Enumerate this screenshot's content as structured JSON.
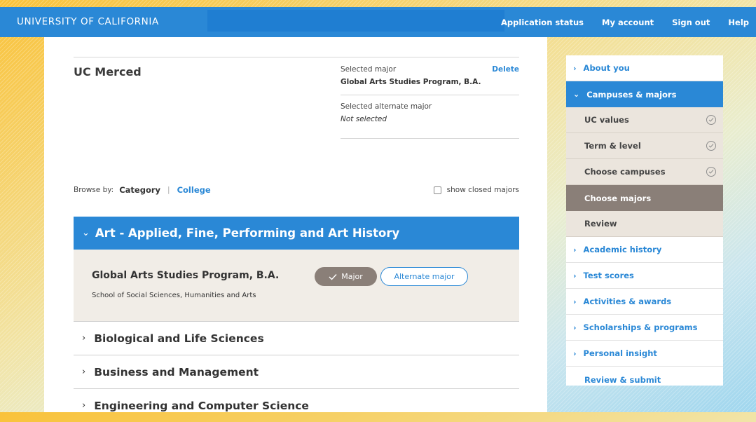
{
  "header": {
    "brand": "UNIVERSITY OF CALIFORNIA",
    "nav": [
      "Application status",
      "My account",
      "Sign out",
      "Help"
    ]
  },
  "main": {
    "campus": "UC Merced",
    "selected_major_label": "Selected major",
    "selected_major_value": "Global Arts Studies Program, B.A.",
    "delete_label": "Delete",
    "alternate_label": "Selected alternate major",
    "alternate_value": "Not selected",
    "browse_label": "Browse by:",
    "browse_category": "Category",
    "browse_college": "College",
    "show_closed_label": "show closed majors",
    "show_closed_checked": false
  },
  "categories": {
    "expanded": {
      "title": "Art - Applied, Fine, Performing and Art History",
      "major_name": "Global Arts Studies Program,  B.A.",
      "school": "School of Social Sciences, Humanities and Arts",
      "major_button": "Major",
      "alternate_button": "Alternate major"
    },
    "collapsed": [
      "Biological and Life Sciences",
      "Business and Management",
      "Engineering and Computer Science"
    ]
  },
  "sidebar": {
    "about": "About you",
    "campuses": "Campuses & majors",
    "sub": [
      "UC values",
      "Term & level",
      "Choose campuses",
      "Choose majors",
      "Review"
    ],
    "rest": [
      "Academic history",
      "Test scores",
      "Activities & awards",
      "Scholarships & programs",
      "Personal insight"
    ],
    "submit": "Review & submit"
  },
  "colors": {
    "accent": "#2a88d6",
    "selected": "#8a7f78",
    "panel": "#f1ede7"
  }
}
